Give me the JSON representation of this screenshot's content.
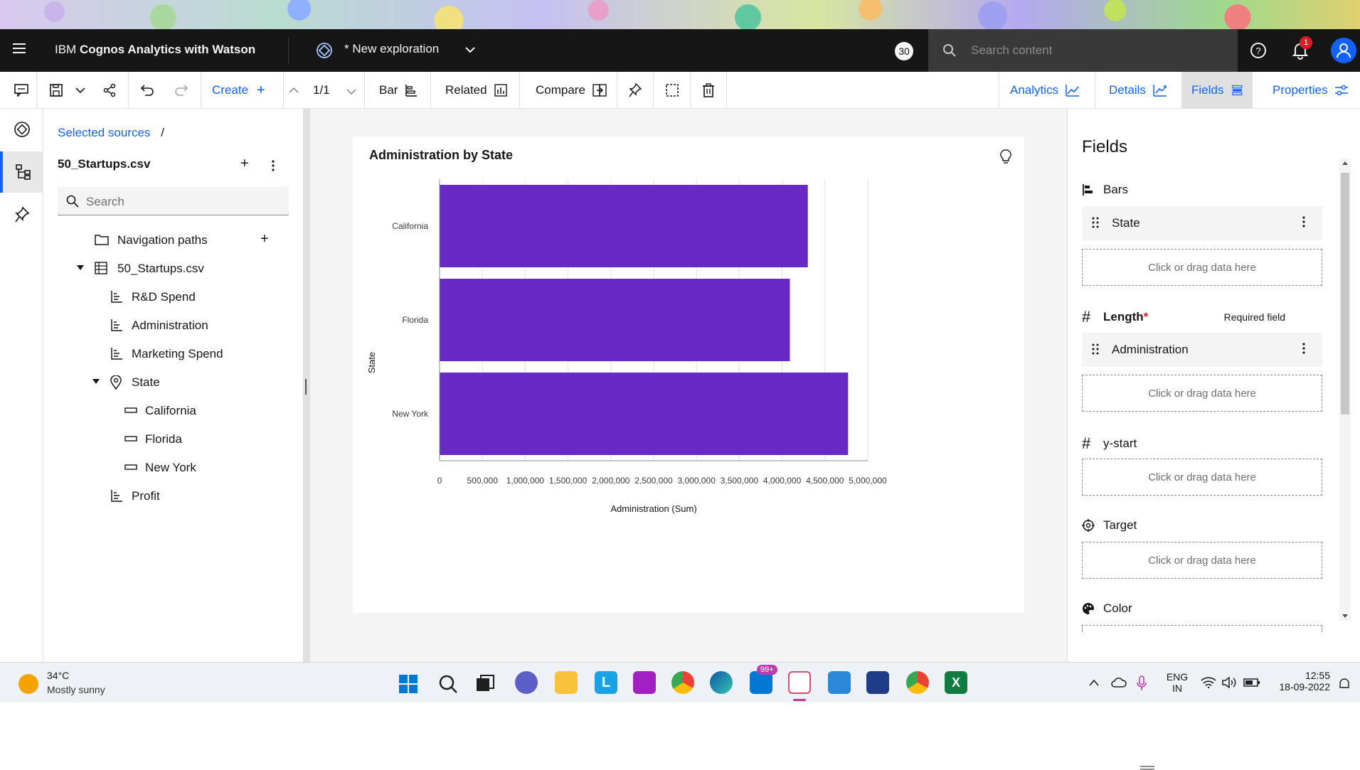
{
  "header": {
    "brand_prefix": "IBM ",
    "brand_bold": "Cognos Analytics with Watson",
    "exploration_title": "* New exploration",
    "counter": "30",
    "search_placeholder": "Search content",
    "notification_count": "1"
  },
  "toolbar": {
    "create_label": "Create",
    "page_indicator": "1/1",
    "bar_label": "Bar",
    "related_label": "Related",
    "compare_label": "Compare",
    "tabs": [
      "Analytics",
      "Details",
      "Fields",
      "Properties"
    ],
    "active_tab": "Fields"
  },
  "sources": {
    "breadcrumb": "Selected sources",
    "breadcrumb_sep": "/",
    "file_title": "50_Startups.csv",
    "search_placeholder": "Search",
    "tree": {
      "nav_paths": "Navigation paths",
      "table": "50_Startups.csv",
      "rd": "R&D Spend",
      "admin": "Administration",
      "marketing": "Marketing Spend",
      "state": "State",
      "california": "California",
      "florida": "Florida",
      "newyork": "New York",
      "profit": "Profit"
    }
  },
  "chart_data": {
    "type": "bar",
    "orientation": "horizontal",
    "title": "Administration by State",
    "xlabel": "Administration (Sum)",
    "ylabel": "State",
    "categories": [
      "California",
      "Florida",
      "New York"
    ],
    "values": [
      4300000,
      4090000,
      4770000
    ],
    "xlim": [
      0,
      5000000
    ],
    "xticks": [
      "0",
      "500,000",
      "1,000,000",
      "1,500,000",
      "2,000,000",
      "2,500,000",
      "3,000,000",
      "3,500,000",
      "4,000,000",
      "4,500,000",
      "5,000,000"
    ],
    "bar_color": "#6929c4",
    "grid": true
  },
  "fields": {
    "heading": "Fields",
    "bars_label": "Bars",
    "bars_value": "State",
    "drop_text": "Click or drag data here",
    "length_label": "Length",
    "required_marker": "*",
    "required_text": "Required field",
    "length_value": "Administration",
    "ystart_label": "y-start",
    "target_label": "Target",
    "color_label": "Color"
  },
  "taskbar": {
    "temperature": "34°C",
    "weather": "Mostly sunny",
    "mail_badge": "99+",
    "lang_line1": "ENG",
    "lang_line2": "IN",
    "time": "12:55",
    "date": "18-09-2022"
  },
  "colors": {
    "accent": "#0f62fe",
    "bar": "#6929c4",
    "header_bg": "#161616"
  }
}
